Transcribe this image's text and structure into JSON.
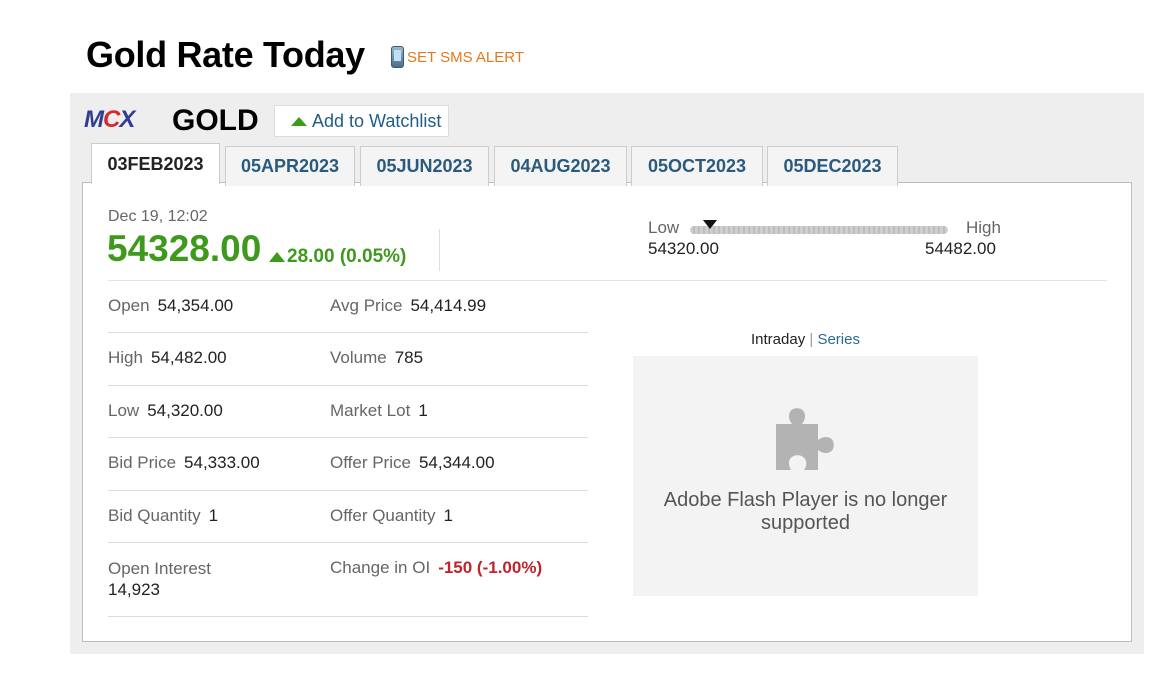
{
  "header": {
    "title": "Gold Rate Today",
    "sms_alert": "SET SMS ALERT"
  },
  "commodity": {
    "exchange_logo": "MCX",
    "name": "GOLD",
    "watchlist_label": "Add to Watchlist"
  },
  "expiry_tabs": [
    {
      "label": "03FEB2023",
      "active": true
    },
    {
      "label": "05APR2023",
      "active": false
    },
    {
      "label": "05JUN2023",
      "active": false
    },
    {
      "label": "04AUG2023",
      "active": false
    },
    {
      "label": "05OCT2023",
      "active": false
    },
    {
      "label": "05DEC2023",
      "active": false
    }
  ],
  "quote": {
    "datetime": "Dec 19, 12:02",
    "price": "54328.00",
    "change": "28.00 (0.05%)",
    "change_color": "#3d9a1c"
  },
  "range": {
    "low_label": "Low",
    "high_label": "High",
    "low_value": "54320.00",
    "high_value": "54482.00",
    "current_fraction": 0.05
  },
  "stats": [
    {
      "left": {
        "key": "Open",
        "value": "54,354.00"
      },
      "right": {
        "key": "Avg Price",
        "value": "54,414.99"
      }
    },
    {
      "left": {
        "key": "High",
        "value": "54,482.00"
      },
      "right": {
        "key": "Volume",
        "value": "785"
      }
    },
    {
      "left": {
        "key": "Low",
        "value": "54,320.00"
      },
      "right": {
        "key": "Market Lot",
        "value": "1"
      }
    },
    {
      "left": {
        "key": "Bid Price",
        "value": "54,333.00"
      },
      "right": {
        "key": "Offer Price",
        "value": "54,344.00"
      }
    },
    {
      "left": {
        "key": "Bid Quantity",
        "value": "1"
      },
      "right": {
        "key": "Offer Quantity",
        "value": "1"
      }
    },
    {
      "left": {
        "key": "Open Interest",
        "value": "14,923"
      },
      "right": {
        "key": "Change in OI",
        "value": "-150 (-1.00%)"
      }
    }
  ],
  "chart_panel": {
    "intraday_label": "Intraday",
    "separator": "|",
    "series_label": "Series",
    "plugin_icon": "puzzle-piece-icon",
    "message": "Adobe Flash Player is no longer supported"
  },
  "colors": {
    "accent_green": "#3d9a1c",
    "negative_red": "#c0242b",
    "link_blue": "#1f5d87",
    "alert_orange": "#e07a1f"
  }
}
